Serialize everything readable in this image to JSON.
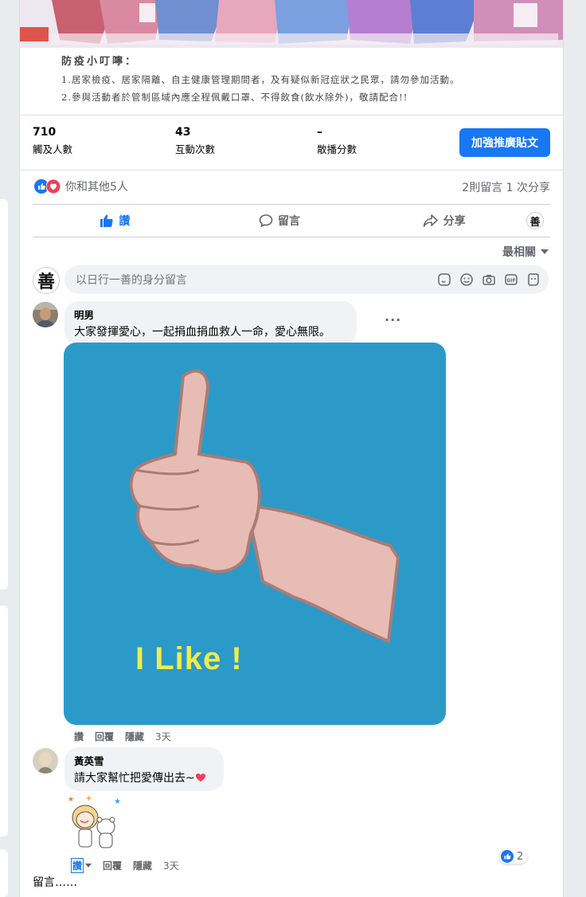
{
  "post": {
    "notice_title": "防疫小叮嚀：",
    "notice_lines": [
      "1.居家檢疫、居家隔離、自主健康管理期間者，及有疑似新冠症狀之民眾，請勿參加活動。",
      "2.參與活動者於管制區域內應全程佩戴口罩、不得飲食(飲水除外)，敬請配合!!"
    ]
  },
  "insights": [
    {
      "value": "710",
      "label": "觸及人數"
    },
    {
      "value": "43",
      "label": "互動次數"
    },
    {
      "value": "–",
      "label": "散播分數"
    }
  ],
  "boost_label": "加強推廣貼文",
  "reactions": {
    "text": "你和其他5人",
    "counts": "2則留言  1 次分享",
    "icons": [
      "like-icon",
      "love-icon"
    ]
  },
  "actions": {
    "like": "讚",
    "comment": "留言",
    "share": "分享"
  },
  "page_avatar_char": "善",
  "sort_label": "最相關",
  "comment_input": {
    "placeholder": "以日行一善的身分留言",
    "icons": [
      "sticker-icon",
      "emoji-icon",
      "camera-icon",
      "gif-icon",
      "avatar-sticker-icon"
    ]
  },
  "comments": [
    {
      "name": "明男",
      "text": "大家發揮愛心，一起捐血捐血救人一命，愛心無限。",
      "sticker_text": "I Like !",
      "actions": [
        "讚",
        "回覆",
        "隱藏"
      ],
      "time": "3天"
    },
    {
      "name": "黃英雪",
      "text": "請大家幫忙把愛傳出去~",
      "actions": [
        "讚",
        "回覆",
        "隱藏"
      ],
      "time": "3天",
      "like_count": "2"
    }
  ],
  "footer_text": "留言……",
  "colors": {
    "accent": "#1877f2",
    "sticker_bg": "#2b9ac9",
    "sticker_text": "#f2ec4a",
    "heart": "#f33e58"
  }
}
